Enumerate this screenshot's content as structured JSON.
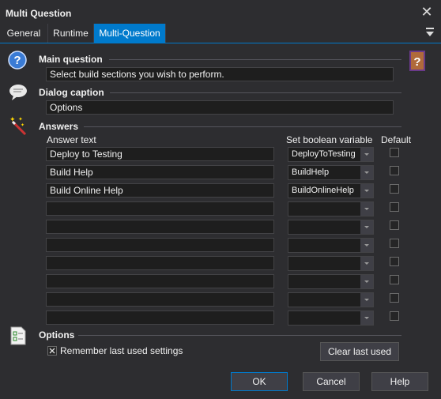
{
  "window": {
    "title": "Multi Question"
  },
  "tabs": [
    {
      "label": "General"
    },
    {
      "label": "Runtime"
    },
    {
      "label": "Multi-Question",
      "active": true
    }
  ],
  "main_question": {
    "label": "Main question",
    "value": "Select build sections you wish to perform."
  },
  "dialog_caption": {
    "label": "Dialog caption",
    "value": "Options"
  },
  "answers": {
    "label": "Answers",
    "col_answer": "Answer text",
    "col_variable": "Set boolean variable",
    "col_default": "Default",
    "rows": [
      {
        "text": "Deploy to Testing",
        "variable": "DeployToTesting",
        "default": false
      },
      {
        "text": "Build Help",
        "variable": "BuildHelp",
        "default": false
      },
      {
        "text": "Build Online Help",
        "variable": "BuildOnlineHelp",
        "default": false
      },
      {
        "text": "",
        "variable": "",
        "default": false
      },
      {
        "text": "",
        "variable": "",
        "default": false
      },
      {
        "text": "",
        "variable": "",
        "default": false
      },
      {
        "text": "",
        "variable": "",
        "default": false
      },
      {
        "text": "",
        "variable": "",
        "default": false
      },
      {
        "text": "",
        "variable": "",
        "default": false
      },
      {
        "text": "",
        "variable": "",
        "default": false
      }
    ]
  },
  "options": {
    "label": "Options",
    "remember_label": "Remember last used settings",
    "remember_checked": true,
    "clear_label": "Clear last used"
  },
  "buttons": {
    "ok": "OK",
    "cancel": "Cancel",
    "help": "Help"
  },
  "colors": {
    "accent": "#007acc",
    "background": "#2d2d30",
    "field": "#1e1e1e"
  }
}
